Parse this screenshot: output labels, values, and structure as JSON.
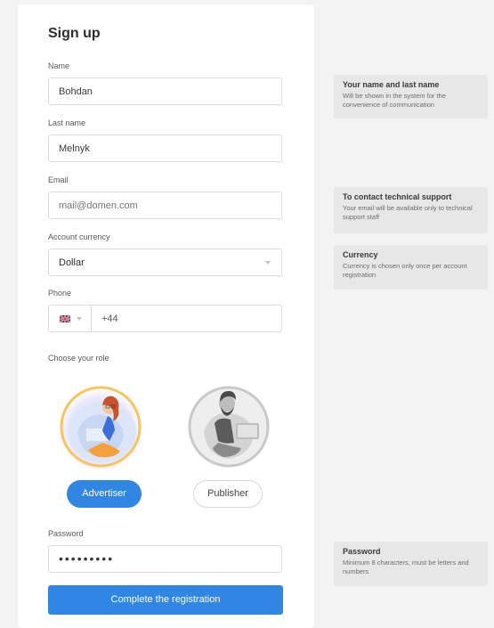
{
  "form": {
    "title": "Sign up",
    "name": {
      "label": "Name",
      "value": "Bohdan"
    },
    "last_name": {
      "label": "Last name",
      "value": "Melnyk"
    },
    "email": {
      "label": "Email",
      "placeholder": "mail@domen.com"
    },
    "currency": {
      "label": "Account currency",
      "value": "Dollar"
    },
    "phone": {
      "label": "Phone",
      "code": "+44",
      "flag": "uk-flag-icon"
    },
    "role": {
      "label": "Choose your role",
      "options": [
        {
          "label": "Advertiser",
          "selected": true
        },
        {
          "label": "Publisher",
          "selected": false
        }
      ]
    },
    "password": {
      "label": "Password",
      "dots": "•••••••••"
    },
    "submit_label": "Complete the registration"
  },
  "tips": [
    {
      "title": "Your name and last name",
      "text": "Will be shown in the system for the convenience of communication"
    },
    {
      "title": "To contact technical support",
      "text": "Your email will be available only to technical support staff"
    },
    {
      "title": "Currency",
      "text": "Currency is chosen only once per account registration"
    },
    {
      "title": "Password",
      "text": "Minimum 8 characters, must be letters and numbers"
    }
  ],
  "colors": {
    "accent": "#2f86e3",
    "tip_bg": "#e7e7e8",
    "page_bg": "#f3f3f4"
  }
}
